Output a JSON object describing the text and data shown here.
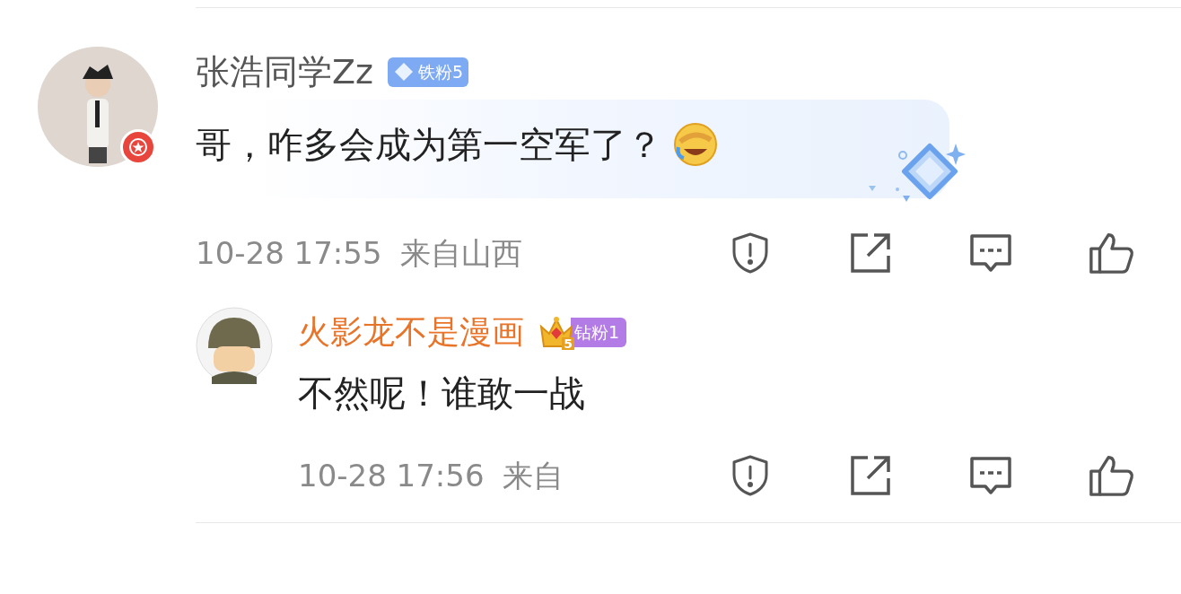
{
  "comment": {
    "username": "张浩同学Zz",
    "badge": {
      "kind": "iron",
      "label": "铁粉5"
    },
    "verified": true,
    "text": "哥，咋多会成为第一空军了？",
    "emoji": true,
    "time": "10-28 17:55",
    "location": "来自山西",
    "reply": {
      "username": "火影龙不是漫画",
      "badge": {
        "kind": "diamond",
        "label": "钻粉1",
        "crown_level": "5"
      },
      "text": "不然呢！谁敢一战",
      "time": "10-28 17:56",
      "location": "来自"
    }
  }
}
